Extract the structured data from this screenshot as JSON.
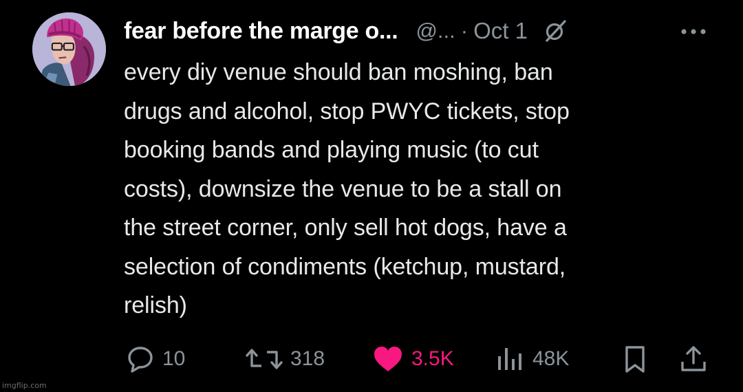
{
  "tweet": {
    "display_name": "fear before the marge o...",
    "handle": "@...",
    "separator": "·",
    "date": "Oct 1",
    "text": "every diy venue should ban moshing, ban\ndrugs and alcohol, stop PWYC tickets, stop\nbooking bands and playing music (to cut\ncosts), downsize the venue to be a stall on\nthe street corner, only sell hot dogs, have a\nselection of condiments (ketchup, mustard,\nrelish)"
  },
  "actions": {
    "replies": "10",
    "reposts": "318",
    "likes": "3.5K",
    "views": "48K"
  },
  "icons": {
    "avatar": "avatar-illustration",
    "grok": "grok-icon",
    "more": "more-dots-icon",
    "reply": "reply-bubble-icon",
    "repost": "repost-arrows-icon",
    "like": "heart-icon",
    "views": "bar-chart-icon",
    "bookmark": "bookmark-icon",
    "share": "share-icon"
  },
  "colors": {
    "background": "#000000",
    "text": "#e7e9ea",
    "muted": "#8b949a",
    "like": "#f91880"
  },
  "watermark": "imgflip.com"
}
